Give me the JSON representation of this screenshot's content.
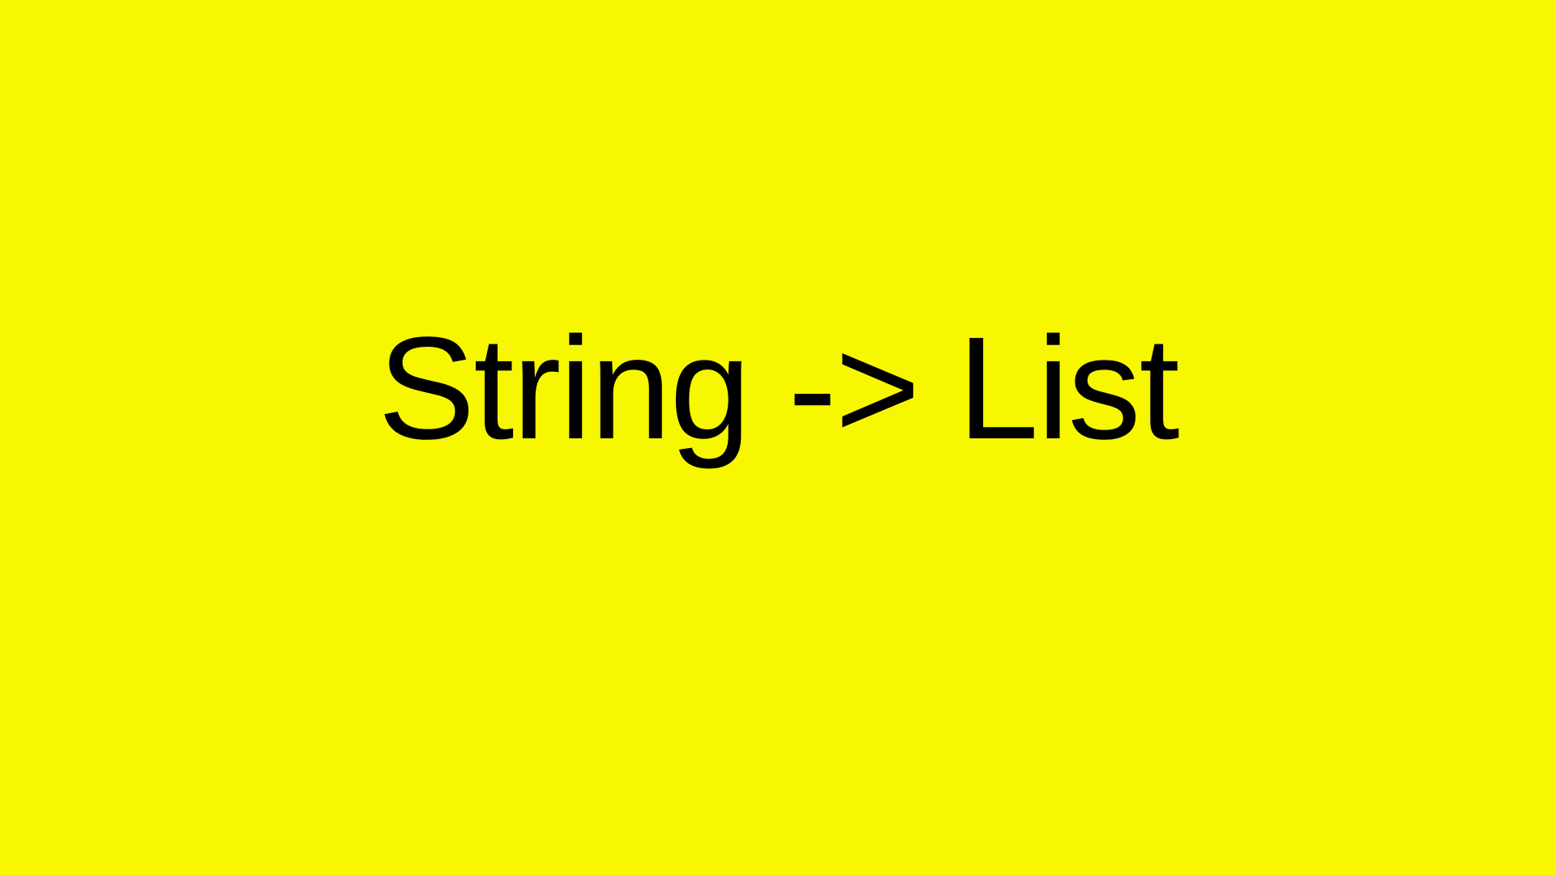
{
  "slide": {
    "title": "String -> List",
    "background_color": "#F7F700",
    "text_color": "#000000"
  }
}
